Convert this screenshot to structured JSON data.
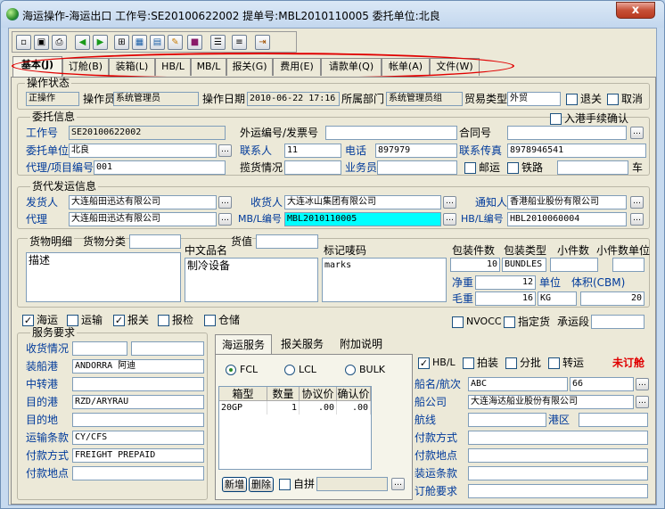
{
  "window": {
    "title": "海运操作-海运出口 工作号:SE20100622002 提单号:MBL2010110005 委托单位:北良",
    "close_label": "x"
  },
  "tabs": [
    "基本(J)",
    "订舱(B)",
    "装箱(L)",
    "HB/L",
    "MB/L",
    "报关(G)",
    "费用(E)",
    "请款单(Q)",
    "帐单(A)",
    "文件(W)"
  ],
  "op_status": {
    "group_title": "操作状态",
    "status_value": "正操作",
    "operator_label": "操作员",
    "operator_value": "系统管理员",
    "date_label": "操作日期",
    "date_value": "2010-06-22 17:16",
    "dept_label": "所属部门",
    "dept_value": "系统管理员组",
    "trade_label": "贸易类型",
    "trade_value": "外贸",
    "return_label": "退关",
    "cancel_label": "取消"
  },
  "consign": {
    "group_title": "委托信息",
    "customs_confirm_label": "入港手续确认",
    "job_no_label": "工作号",
    "job_no_value": "SE20100622002",
    "invoice_label": "外运编号/发票号",
    "invoice_value": "",
    "contract_label": "合同号",
    "contract_value": "",
    "client_label": "委托单位",
    "client_value": "北良",
    "contact_label": "联系人",
    "contact_value": "11",
    "phone_label": "电话",
    "phone_value": "897979",
    "fax_label": "联系传真",
    "fax_value": "8978946541",
    "agent_label": "代理/项目编号",
    "agent_value": "001",
    "pickup_label": "揽货情况",
    "pickup_value": "",
    "salesman_label": "业务员",
    "salesman_value": "",
    "mail_label": "邮运",
    "rail_label": "铁路",
    "rail_value": "",
    "car_label": "车"
  },
  "parties": {
    "group_title": "货代发运信息",
    "shipper_label": "发货人",
    "shipper_value": "大连船田迅达有限公司",
    "consignee_label": "收货人",
    "consignee_value": "大连冰山集团有限公司",
    "notify_label": "通知人",
    "notify_value": "香港船业股份有限公司",
    "agent_label": "代理",
    "agent_value": "大连船田迅达有限公司",
    "mbl_label": "MB/L编号",
    "mbl_value": "MBL2010110005",
    "hbl_label": "HB/L编号",
    "hbl_value": "HBL2010060004"
  },
  "cargo": {
    "detail_label": "货物明细",
    "category_label": "货物分类",
    "category_value": "",
    "value_label": "货值",
    "value_value": "",
    "desc_value": "描述",
    "cn_name_label": "中文品名",
    "cn_name_value": "制冷设备",
    "marks_label": "标记唛码",
    "marks_value": "marks",
    "pkg_count_label": "包装件数",
    "pkg_count_value": "10",
    "pkg_type_label": "包装类型",
    "pkg_type_value": "BUNDLES",
    "piece_label": "小件数",
    "piece_value": "",
    "piece_unit_label": "小件数单位",
    "piece_unit_value": "",
    "net_label": "净重",
    "net_value": "12",
    "unit_label": "单位",
    "unit_value": "KG",
    "volume_label": "体积(CBM)",
    "volume_value": "20",
    "gross_label": "毛重",
    "gross_value": "16"
  },
  "services": {
    "sea_label": "海运",
    "land_label": "运输",
    "customs_label": "报关",
    "inspect_label": "报检",
    "warehouse_label": "仓储",
    "nvocc_label": "NVOCC",
    "designated_label": "指定货",
    "carrier_label": "承运段",
    "carrier_value": ""
  },
  "requirements": {
    "group_title": "服务要求",
    "receive_label": "收货情况",
    "load_port_label": "装船港",
    "load_port_value": "ANDORRA 阿迪",
    "transit_label": "中转港",
    "transit_value": "",
    "dest_port_label": "目的港",
    "dest_port_value": "RZD/ARYRAU",
    "dest_label": "目的地",
    "dest_value": "",
    "terms_label": "运输条款",
    "terms_value": "CY/CFS",
    "payment_label": "付款方式",
    "payment_value": "FREIGHT PREPAID",
    "pay_place_label": "付款地点",
    "pay_place_value": ""
  },
  "service_tabs": [
    "海运服务",
    "报关服务",
    "附加说明"
  ],
  "sea_service": {
    "fcl_label": "FCL",
    "lcl_label": "LCL",
    "bulk_label": "BULK",
    "columns": [
      "箱型",
      "数量",
      "协议价",
      "确认价"
    ],
    "rows": [
      [
        "20GP",
        "1",
        ".00",
        ".00"
      ]
    ],
    "new_label": "新增",
    "delete_label": "删除",
    "self_pack_label": "自拼",
    "self_pack_value": ""
  },
  "booking": {
    "hbl_label": "HB/L",
    "pack_label": "拍装",
    "split_label": "分批",
    "transship_label": "转运",
    "status_text": "未订舱",
    "vessel_label": "船名/航次",
    "vessel_value": "ABC",
    "voyage_value": "66",
    "carrier_label": "船公司",
    "carrier_value": "大连海达船业股份有限公司",
    "route_label": "航线",
    "route_value": "",
    "area_label": "港区",
    "area_value": "",
    "pay_method_label": "付款方式",
    "pay_method_value": "",
    "pay_place_label": "付款地点",
    "pay_place_value": "",
    "load_req_label": "装运条款",
    "load_req_value": "",
    "booking_req_label": "订舱要求",
    "booking_req_value": ""
  },
  "colors": {
    "highlight": "#00ffff",
    "alert": "#e00000",
    "circle": "#e00000"
  }
}
